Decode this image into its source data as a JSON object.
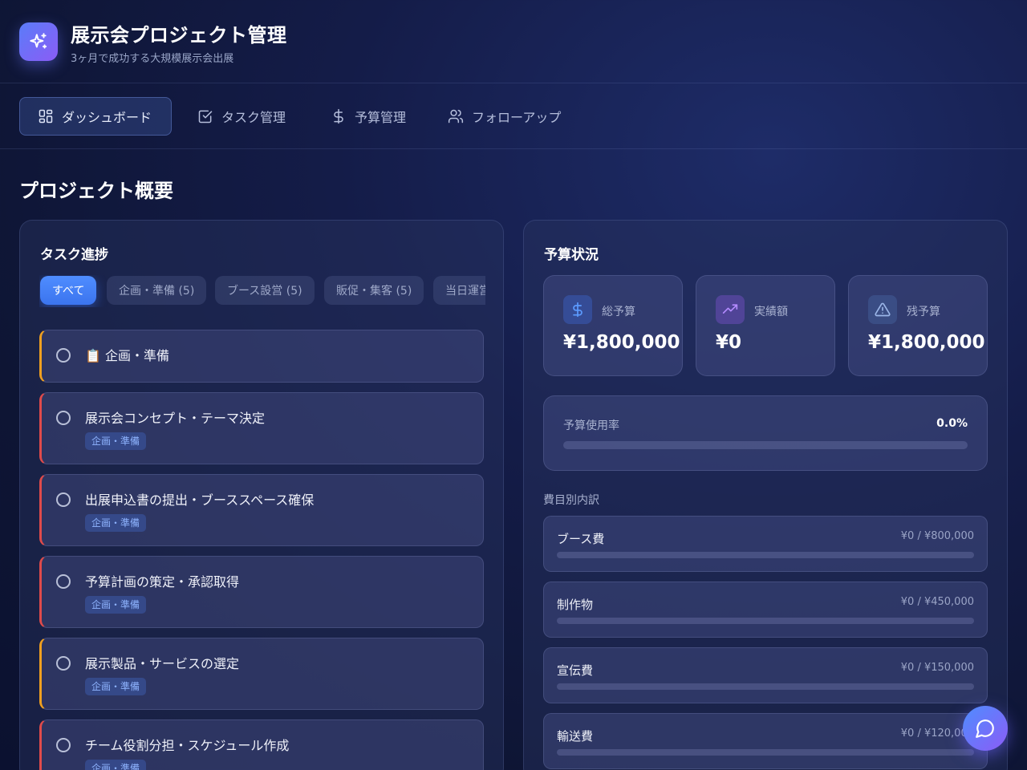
{
  "header": {
    "title": "展示会プロジェクト管理",
    "subtitle": "3ヶ月で成功する大規模展示会出展",
    "logo_icon": "sparkles-icon"
  },
  "nav": {
    "tabs": [
      {
        "label": "ダッシュボード",
        "icon": "dashboard-grid-icon",
        "active": true
      },
      {
        "label": "タスク管理",
        "icon": "checkbox-icon",
        "active": false
      },
      {
        "label": "予算管理",
        "icon": "dollar-icon",
        "active": false
      },
      {
        "label": "フォローアップ",
        "icon": "users-icon",
        "active": false
      }
    ]
  },
  "main": {
    "section_title": "プロジェクト概要"
  },
  "tasks_panel": {
    "title": "タスク進捗",
    "filters": [
      {
        "label": "すべて",
        "active": true
      },
      {
        "label": "企画・準備 (5)",
        "active": false
      },
      {
        "label": "ブース設営 (5)",
        "active": false
      },
      {
        "label": "販促・集客 (5)",
        "active": false
      },
      {
        "label": "当日運営",
        "active": false
      }
    ],
    "items": [
      {
        "title": "📋 企画・準備",
        "tag": "",
        "priority": "orange"
      },
      {
        "title": "展示会コンセプト・テーマ決定",
        "tag": "企画・準備",
        "priority": "red"
      },
      {
        "title": "出展申込書の提出・ブーススペース確保",
        "tag": "企画・準備",
        "priority": "red"
      },
      {
        "title": "予算計画の策定・承認取得",
        "tag": "企画・準備",
        "priority": "red"
      },
      {
        "title": "展示製品・サービスの選定",
        "tag": "企画・準備",
        "priority": "orange"
      },
      {
        "title": "チーム役割分担・スケジュール作成",
        "tag": "企画・準備",
        "priority": "red"
      }
    ]
  },
  "budget_panel": {
    "title": "予算状況",
    "stats": [
      {
        "label": "総予算",
        "value": "¥1,800,000",
        "icon": "dollar-icon",
        "color": "#4f8dff"
      },
      {
        "label": "実績額",
        "value": "¥0",
        "icon": "trending-up-icon",
        "color": "#a87bff"
      },
      {
        "label": "残予算",
        "value": "¥1,800,000",
        "icon": "warning-triangle-icon",
        "color": "#8fb0e8"
      }
    ],
    "usage_label": "予算使用率",
    "usage_value": "0.0%",
    "usage_fraction": 0.0,
    "breakdown_label": "費目別内訳",
    "costs": [
      {
        "name": "ブース費",
        "amount": "¥0 / ¥800,000",
        "fraction": 0.0
      },
      {
        "name": "制作物",
        "amount": "¥0 / ¥450,000",
        "fraction": 0.0
      },
      {
        "name": "宣伝費",
        "amount": "¥0 / ¥150,000",
        "fraction": 0.0
      },
      {
        "name": "輸送費",
        "amount": "¥0 / ¥120,000",
        "fraction": 0.0
      }
    ]
  },
  "chat": {
    "icon": "chat-bubble-icon"
  },
  "colors": {
    "accent": "#4f8dff",
    "accent_purple": "#8b5cf6",
    "priority_high": "#e04b4b",
    "priority_medium": "#f0a020"
  }
}
